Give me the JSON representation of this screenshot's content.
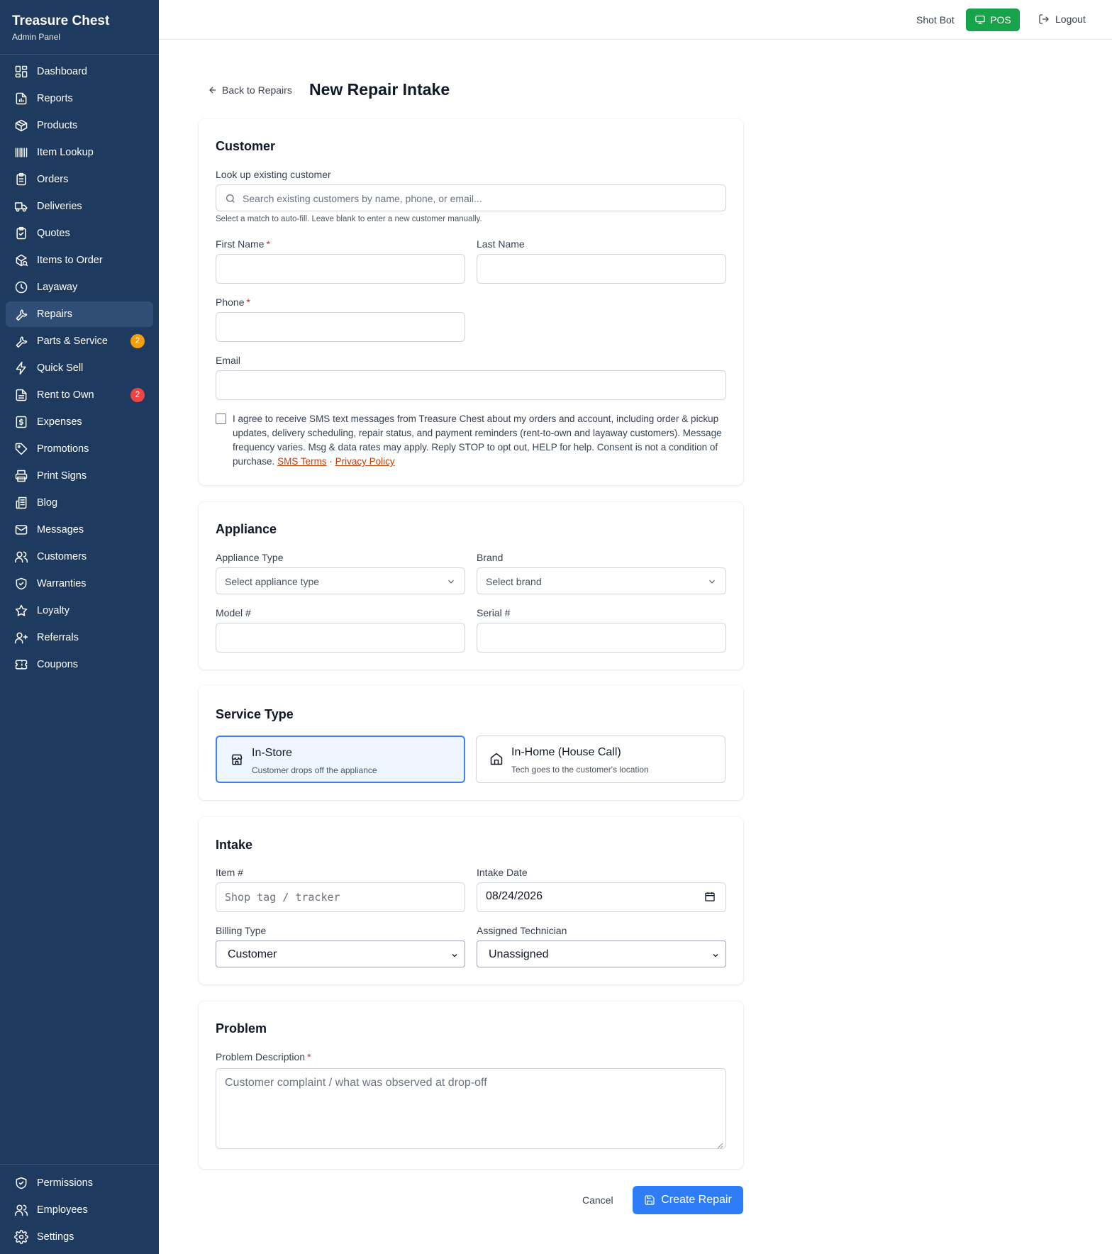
{
  "brand": {
    "title": "Treasure Chest",
    "subtitle": "Admin Panel"
  },
  "sidebar": {
    "items": [
      {
        "label": "Dashboard",
        "icon": "dashboard-icon"
      },
      {
        "label": "Reports",
        "icon": "report-icon"
      },
      {
        "label": "Products",
        "icon": "package-icon"
      },
      {
        "label": "Item Lookup",
        "icon": "barcode-icon"
      },
      {
        "label": "Orders",
        "icon": "clipboard-list-icon"
      },
      {
        "label": "Deliveries",
        "icon": "truck-icon"
      },
      {
        "label": "Quotes",
        "icon": "clipboard-check-icon"
      },
      {
        "label": "Items to Order",
        "icon": "package-search-icon"
      },
      {
        "label": "Layaway",
        "icon": "clock-icon"
      },
      {
        "label": "Repairs",
        "icon": "wrench-icon",
        "active": true
      },
      {
        "label": "Parts & Service",
        "icon": "wrench-icon",
        "badge": "2"
      },
      {
        "label": "Quick Sell",
        "icon": "lightning-icon"
      },
      {
        "label": "Rent to Own",
        "icon": "document-icon",
        "badge": "2"
      },
      {
        "label": "Expenses",
        "icon": "dollar-receipt-icon"
      },
      {
        "label": "Promotions",
        "icon": "tag-icon"
      },
      {
        "label": "Print Signs",
        "icon": "printer-icon"
      },
      {
        "label": "Blog",
        "icon": "newspaper-icon"
      },
      {
        "label": "Messages",
        "icon": "mail-icon"
      },
      {
        "label": "Customers",
        "icon": "users-icon"
      },
      {
        "label": "Warranties",
        "icon": "shield-check-icon"
      },
      {
        "label": "Loyalty",
        "icon": "star-icon"
      },
      {
        "label": "Referrals",
        "icon": "user-plus-icon"
      },
      {
        "label": "Coupons",
        "icon": "ticket-icon"
      }
    ],
    "bottom_items": [
      {
        "label": "Permissions",
        "icon": "shield-check-icon"
      },
      {
        "label": "Employees",
        "icon": "users-icon"
      },
      {
        "label": "Settings",
        "icon": "gear-icon"
      }
    ]
  },
  "topbar": {
    "user": "Shot Bot",
    "pos_label": "POS",
    "logout_label": "Logout"
  },
  "header": {
    "back_label": "Back to Repairs",
    "title": "New Repair Intake"
  },
  "customer": {
    "title": "Customer",
    "lookup_label": "Look up existing customer",
    "lookup_placeholder": "Search existing customers by name, phone, or email...",
    "lookup_hint": "Select a match to auto-fill. Leave blank to enter a new customer manually.",
    "first_name_label": "First Name",
    "last_name_label": "Last Name",
    "phone_label": "Phone",
    "email_label": "Email",
    "required_mark": "*",
    "consent_text": "I agree to receive SMS text messages from Treasure Chest about my orders and account, including order & pickup updates, delivery scheduling, repair status, and payment reminders (rent-to-own and layaway customers). Message frequency varies. Msg & data rates may apply. Reply STOP to opt out, HELP for help. Consent is not a condition of purchase.",
    "sms_terms_label": "SMS Terms",
    "separator": "·",
    "privacy_label": "Privacy Policy"
  },
  "appliance": {
    "title": "Appliance",
    "type_label": "Appliance Type",
    "type_placeholder": "Select appliance type",
    "brand_label": "Brand",
    "brand_placeholder": "Select brand",
    "model_label": "Model #",
    "serial_label": "Serial #"
  },
  "service": {
    "title": "Service Type",
    "options": [
      {
        "title": "In-Store",
        "desc": "Customer drops off the appliance",
        "selected": true
      },
      {
        "title": "In-Home (House Call)",
        "desc": "Tech goes to the customer's location",
        "selected": false
      }
    ]
  },
  "intake": {
    "title": "Intake",
    "item_label": "Item #",
    "item_placeholder": "Shop tag / tracker",
    "date_label": "Intake Date",
    "date_value": "08/24/2026",
    "billing_label": "Billing Type",
    "billing_value": "Customer",
    "tech_label": "Assigned Technician",
    "tech_value": "Unassigned"
  },
  "problem": {
    "title": "Problem",
    "desc_label": "Problem Description",
    "desc_placeholder": "Customer complaint / what was observed at drop-off"
  },
  "actions": {
    "cancel_label": "Cancel",
    "create_label": "Create Repair"
  },
  "colors": {
    "sidebar_bg": "#1f3a5f",
    "pos_green": "#16a34a",
    "primary_blue": "#2f7df6",
    "link_orange": "#c2410c"
  }
}
